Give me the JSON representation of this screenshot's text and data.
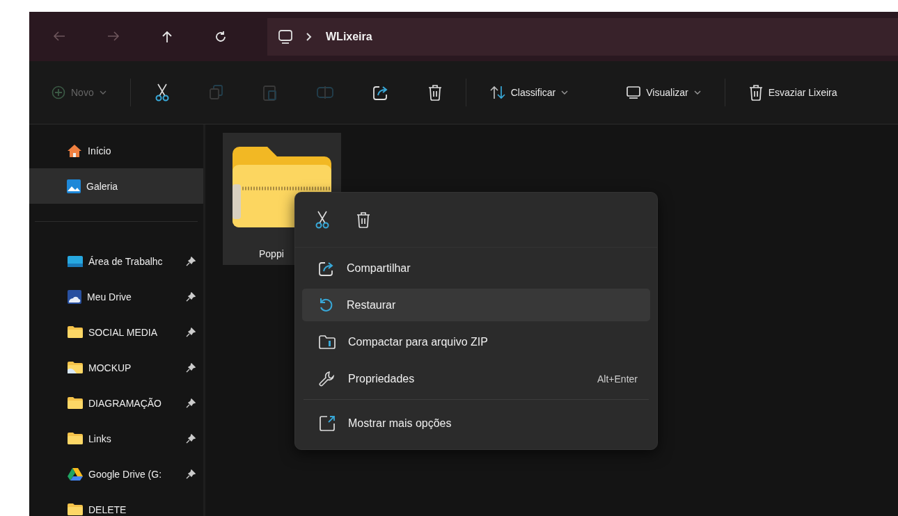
{
  "address_bar": {
    "nav": [
      {
        "kind": "back",
        "disabled": true
      },
      {
        "kind": "forward",
        "disabled": true
      },
      {
        "kind": "up",
        "disabled": false
      },
      {
        "kind": "refresh",
        "disabled": false
      }
    ],
    "path": "WLixeira"
  },
  "toolbar": {
    "new": {
      "label": "Novo",
      "disabled": true
    },
    "actions": [
      {
        "kind": "cut",
        "disabled": false
      },
      {
        "kind": "copy",
        "disabled": true
      },
      {
        "kind": "paste",
        "disabled": true
      },
      {
        "kind": "rename",
        "disabled": true
      },
      {
        "kind": "share",
        "disabled": false
      },
      {
        "kind": "delete",
        "disabled": false
      }
    ],
    "menus": [
      {
        "kind": "sort",
        "label": "Classificar"
      },
      {
        "kind": "view",
        "label": "Visualizar"
      }
    ],
    "empty": {
      "label": "Esvaziar Lixeira"
    }
  },
  "sidebar": {
    "top": [
      {
        "kind": "home",
        "label": "Início",
        "selected": false
      },
      {
        "kind": "gallery",
        "label": "Galeria",
        "selected": true
      }
    ],
    "pinned": [
      {
        "kind": "desktop",
        "label": "Área de Trabalhc",
        "pinned": true
      },
      {
        "kind": "drive",
        "label": "Meu Drive",
        "pinned": true
      },
      {
        "kind": "folder",
        "label": "SOCIAL MEDIA",
        "pinned": true
      },
      {
        "kind": "photos",
        "label": "MOCKUP",
        "pinned": true
      },
      {
        "kind": "folder",
        "label": "DIAGRAMAÇÃO",
        "pinned": true
      },
      {
        "kind": "folder",
        "label": "Links",
        "pinned": true
      },
      {
        "kind": "gdrive",
        "label": "Google Drive (G:",
        "pinned": true
      },
      {
        "kind": "folder",
        "label": "DELETE"
      }
    ]
  },
  "files": [
    {
      "name": "Poppi",
      "selected": true
    }
  ],
  "context_menu": {
    "quick": [
      {
        "kind": "cut"
      },
      {
        "kind": "delete"
      }
    ],
    "items": [
      {
        "kind": "share",
        "label": "Compartilhar",
        "selected": false
      },
      {
        "kind": "restore",
        "label": "Restaurar",
        "selected": true
      },
      {
        "kind": "zip",
        "label": "Compactar para arquivo ZIP",
        "selected": false
      },
      {
        "kind": "props",
        "label": "Propriedades",
        "shortcut": "Alt+Enter",
        "selected": false
      },
      {
        "kind": "separator"
      },
      {
        "kind": "more",
        "label": "Mostrar mais opções",
        "selected": false
      }
    ]
  }
}
